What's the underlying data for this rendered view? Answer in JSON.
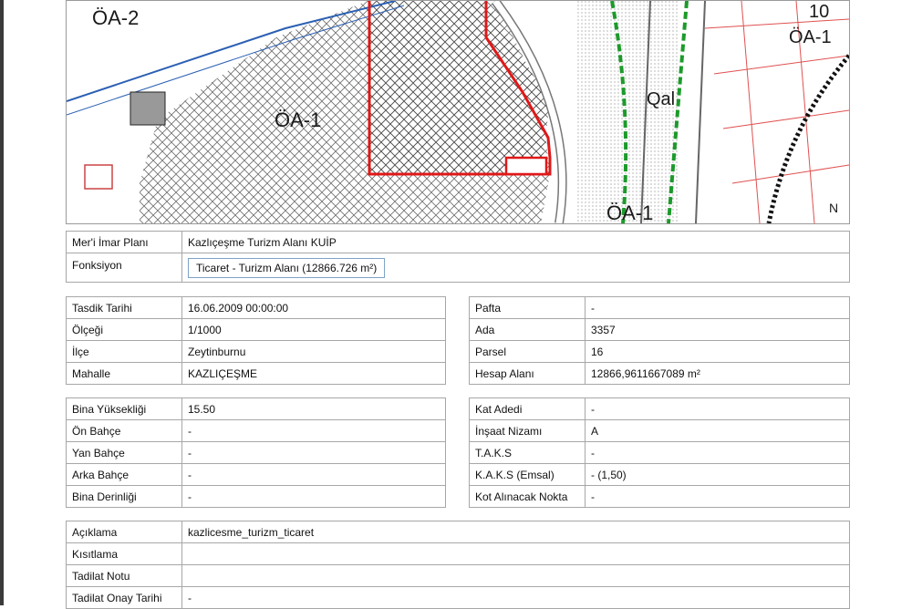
{
  "map": {
    "labels": {
      "oa2": "ÖA-2",
      "oa1": "ÖA-1",
      "oa1_south": "ÖA-1",
      "oa_right": "ÖA-1",
      "qal": "Qal",
      "ten": "10",
      "north": "N"
    }
  },
  "plan": {
    "rows": [
      {
        "label": "Mer'i İmar Planı",
        "value": "Kazlıçeşme Turizm Alanı KUİP"
      },
      {
        "label": "Fonksiyon",
        "value": "Ticaret - Turizm Alanı (12866.726 m²)"
      }
    ]
  },
  "parcel_left": {
    "rows": [
      {
        "label": "Tasdik Tarihi",
        "value": "16.06.2009 00:00:00"
      },
      {
        "label": "Ölçeği",
        "value": "1/1000"
      },
      {
        "label": "İlçe",
        "value": "Zeytinburnu"
      },
      {
        "label": "Mahalle",
        "value": "KAZLIÇEŞME"
      }
    ]
  },
  "parcel_right": {
    "rows": [
      {
        "label": "Pafta",
        "value": "-"
      },
      {
        "label": "Ada",
        "value": "3357"
      },
      {
        "label": "Parsel",
        "value": "16"
      },
      {
        "label": "Hesap Alanı",
        "value": "12866,9611667089 m²"
      }
    ]
  },
  "building_left": {
    "rows": [
      {
        "label": "Bina Yüksekliği",
        "value": "15.50"
      },
      {
        "label": "Ön Bahçe",
        "value": "-"
      },
      {
        "label": "Yan Bahçe",
        "value": "-"
      },
      {
        "label": "Arka Bahçe",
        "value": "-"
      },
      {
        "label": "Bina Derinliği",
        "value": "-"
      }
    ]
  },
  "building_right": {
    "rows": [
      {
        "label": "Kat Adedi",
        "value": "-"
      },
      {
        "label": "İnşaat Nizamı",
        "value": "A"
      },
      {
        "label": "T.A.K.S",
        "value": "-"
      },
      {
        "label": "K.A.K.S (Emsal)",
        "value": "- (1,50)"
      },
      {
        "label": "Kot Alınacak Nokta",
        "value": "-"
      }
    ]
  },
  "notes": {
    "rows": [
      {
        "label": "Açıklama",
        "value": "kazlicesme_turizm_ticaret"
      },
      {
        "label": "Kısıtlama",
        "value": ""
      },
      {
        "label": "Tadilat Notu",
        "value": ""
      },
      {
        "label": "Tadilat Onay Tarihi",
        "value": "-"
      }
    ]
  }
}
